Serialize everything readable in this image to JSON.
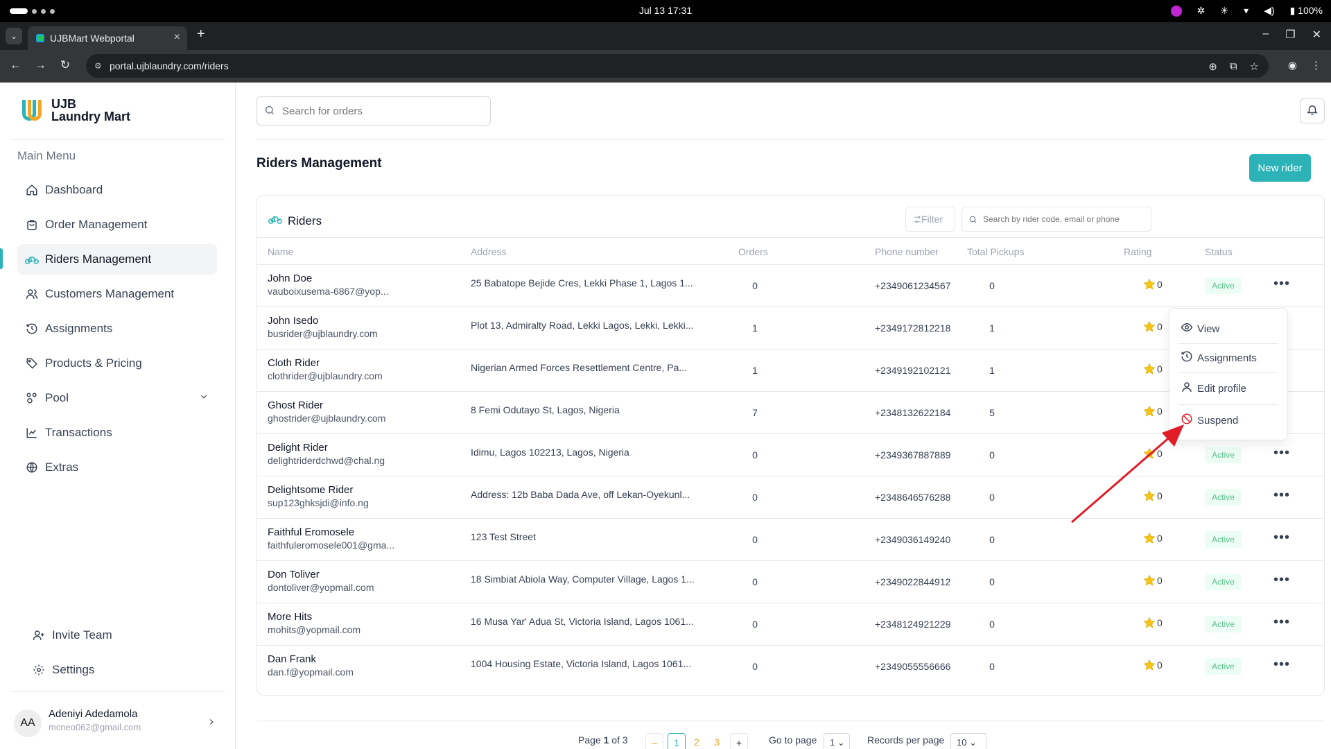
{
  "os": {
    "clock": "Jul 13  17:31",
    "battery": "100%"
  },
  "browser": {
    "tab_title": "UJBMart Webportal",
    "url": "portal.ujblaundry.com/riders"
  },
  "brand": {
    "line1": "UJB",
    "line2": "Laundry Mart"
  },
  "sidebar": {
    "menu_title": "Main Menu",
    "items": [
      {
        "label": "Dashboard",
        "icon": "home-icon"
      },
      {
        "label": "Order Management",
        "icon": "shopping-bag-icon"
      },
      {
        "label": "Riders Management",
        "icon": "bicycle-icon"
      },
      {
        "label": "Customers Management",
        "icon": "users-icon"
      },
      {
        "label": "Assignments",
        "icon": "history-icon"
      },
      {
        "label": "Products & Pricing",
        "icon": "tags-icon"
      },
      {
        "label": "Pool",
        "icon": "pool-icon"
      },
      {
        "label": "Transactions",
        "icon": "chart-line-icon"
      },
      {
        "label": "Extras",
        "icon": "globe-icon"
      }
    ],
    "bottom_items": [
      {
        "label": "Invite Team",
        "icon": "user-plus-icon"
      },
      {
        "label": "Settings",
        "icon": "gear-icon"
      }
    ],
    "user": {
      "initials": "AA",
      "name": "Adeniyi Adedamola",
      "email": "mcneo062@gmail.com"
    }
  },
  "header": {
    "search_placeholder": "Search for orders"
  },
  "page": {
    "title": "Riders Management",
    "new_button": "New rider"
  },
  "riders_card": {
    "title": "Riders",
    "filter_label": "Filter",
    "search_placeholder": "Search by rider code, email or phone",
    "columns": [
      "Name",
      "Address",
      "Orders",
      "Phone number",
      "Total Pickups",
      "Rating",
      "Status"
    ],
    "rows": [
      {
        "name": "John Doe",
        "email": "vauboixusema-6867@yop...",
        "address": "25 Babatope Bejide Cres, Lekki Phase 1, Lagos 1...",
        "orders": "0",
        "phone": "+2349061234567",
        "pickups": "0",
        "rating": "0",
        "status": "Active"
      },
      {
        "name": "John Isedo",
        "email": "busrider@ujblaundry.com",
        "address": "Plot 13, Admiralty Road, Lekki Lagos, Lekki, Lekki...",
        "orders": "1",
        "phone": "+2349172812218",
        "pickups": "1",
        "rating": "0",
        "status": ""
      },
      {
        "name": "Cloth Rider",
        "email": "clothrider@ujblaundry.com",
        "address": "Nigerian Armed Forces Resettlement Centre, Pa...",
        "orders": "1",
        "phone": "+2349192102121",
        "pickups": "1",
        "rating": "0",
        "status": ""
      },
      {
        "name": "Ghost Rider",
        "email": "ghostrider@ujblaundry.com",
        "address": "8 Femi Odutayo St, Lagos, Nigeria",
        "orders": "7",
        "phone": "+2348132622184",
        "pickups": "5",
        "rating": "0",
        "status": ""
      },
      {
        "name": "Delight Rider",
        "email": "delightriderdchwd@chal.ng",
        "address": "Idimu, Lagos 102213, Lagos, Nigeria",
        "orders": "0",
        "phone": "+2349367887889",
        "pickups": "0",
        "rating": "0",
        "status": "Active"
      },
      {
        "name": "Delightsome Rider",
        "email": "sup123ghksjdi@info.ng",
        "address": "Address: 12b Baba Dada Ave, off Lekan-Oyekunl...",
        "orders": "0",
        "phone": "+2348646576288",
        "pickups": "0",
        "rating": "0",
        "status": "Active"
      },
      {
        "name": "Faithful Eromosele",
        "email": "faithfuleromosele001@gma...",
        "address": "123 Test Street",
        "orders": "0",
        "phone": "+2349036149240",
        "pickups": "0",
        "rating": "0",
        "status": "Active"
      },
      {
        "name": "Don Toliver",
        "email": "dontoliver@yopmail.com",
        "address": "18 Simbiat Abiola Way, Computer Village, Lagos 1...",
        "orders": "0",
        "phone": "+2349022844912",
        "pickups": "0",
        "rating": "0",
        "status": "Active"
      },
      {
        "name": "More Hits",
        "email": "mohits@yopmail.com",
        "address": "16 Musa Yar' Adua St, Victoria Island, Lagos 1061...",
        "orders": "0",
        "phone": "+2348124921229",
        "pickups": "0",
        "rating": "0",
        "status": "Active"
      },
      {
        "name": "Dan Frank",
        "email": "dan.f@yopmail.com",
        "address": "1004 Housing Estate, Victoria Island, Lagos 1061...",
        "orders": "0",
        "phone": "+2349055556666",
        "pickups": "0",
        "rating": "0",
        "status": "Active"
      }
    ]
  },
  "row_menu": {
    "items": [
      {
        "label": "View",
        "icon": "eye-icon"
      },
      {
        "label": "Assignments",
        "icon": "history-icon"
      },
      {
        "label": "Edit profile",
        "icon": "user-icon"
      },
      {
        "label": "Suspend",
        "icon": "ban-icon"
      }
    ]
  },
  "pagination": {
    "page_prefix": "Page",
    "current": "1",
    "of_label": "of",
    "total": "3",
    "pages": [
      "1",
      "2",
      "3"
    ],
    "go_to_label": "Go to page",
    "go_to_value": "1",
    "records_label": "Records per page",
    "records_value": "10"
  },
  "colors": {
    "accent": "#2bb3b7",
    "brand_orange": "#f5a524",
    "active_text": "#5bbf8a",
    "annotation_arrow": "#e11d27"
  }
}
